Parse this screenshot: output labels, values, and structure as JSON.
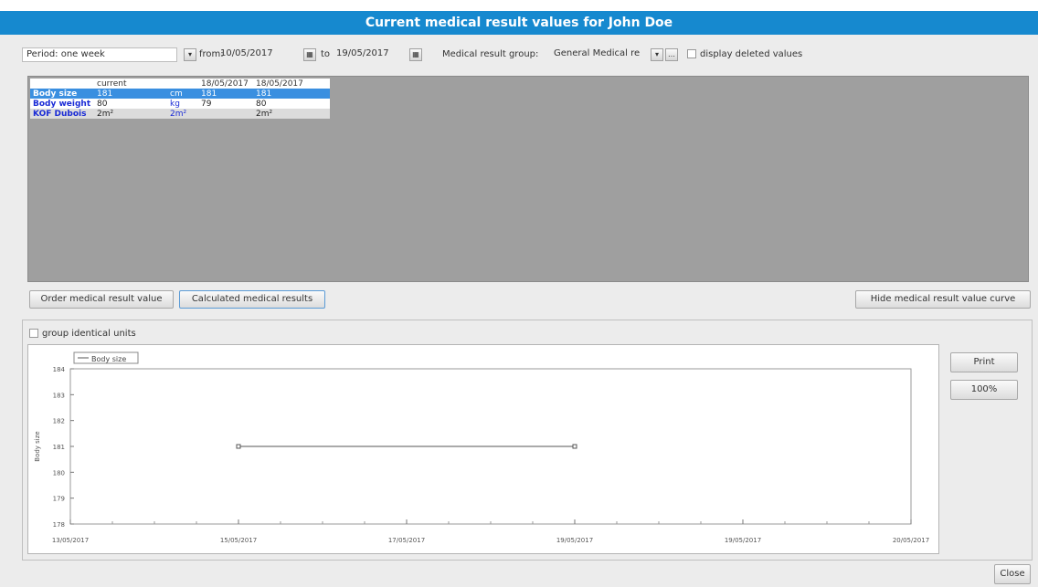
{
  "window": {
    "title": "Current medical result values for John Doe"
  },
  "toolbar": {
    "period_label": "Period: one week",
    "from_label": "from:",
    "from_value": "10/05/2017",
    "to_label": "to",
    "to_value": "19/05/2017",
    "group_label": "Medical result group:",
    "group_value": "General Medical re",
    "display_deleted_label": "display deleted values"
  },
  "grid": {
    "columns": [
      "",
      "current",
      "",
      "18/05/2017",
      "18/05/2017"
    ],
    "rows": [
      {
        "name": "Body size",
        "current": "181",
        "unit": "cm",
        "v1": "181",
        "v2": "181"
      },
      {
        "name": "Body weight",
        "current": "80",
        "unit": "kg",
        "v1": "79",
        "v2": "80"
      },
      {
        "name": "KOF Dubois",
        "current": "2m²",
        "unit": "2m²",
        "v1": "",
        "v2": "2m²"
      }
    ]
  },
  "buttons": {
    "order": "Order medical result value",
    "calculated": "Calculated medical results",
    "hide_curve": "Hide medical result value curve",
    "print": "Print",
    "zoom": "100%",
    "close": "Close"
  },
  "chart_options": {
    "group_units_label": "group identical units"
  },
  "chart_data": {
    "type": "line",
    "legend": "Body size",
    "ylabel": "Body size",
    "ylim": [
      178,
      184
    ],
    "yticks": [
      "184",
      "183",
      "182",
      "181",
      "180",
      "179",
      "178"
    ],
    "xticks": [
      "13/05/2017",
      "15/05/2017",
      "17/05/2017",
      "19/05/2017",
      "19/05/2017",
      "20/05/2017"
    ],
    "series": [
      {
        "name": "Body size",
        "x": [
          "15/05/2017",
          "19/05/2017"
        ],
        "values": [
          181,
          181
        ]
      }
    ],
    "line_color": "#555555"
  }
}
